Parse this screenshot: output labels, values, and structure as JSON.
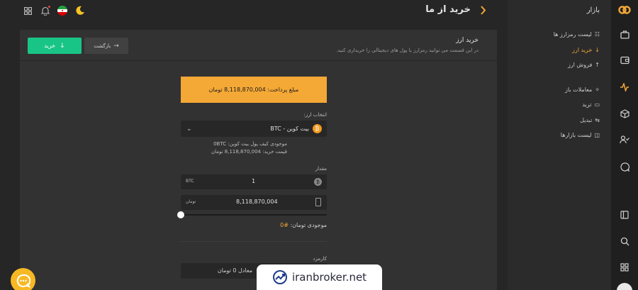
{
  "header": {
    "title": "خرید از ما",
    "chevron": "chevron-right-icon"
  },
  "topicons": [
    "theme-moon-icon",
    "iran-flag-icon",
    "bell-icon",
    "grid-icon"
  ],
  "colors": {
    "accent": "#f4a836",
    "green": "#19c586",
    "bg": "#262627",
    "panel": "#323233"
  },
  "page": {
    "title": "خرید ارز",
    "subtitle": "در این قسمت می توانید رمزارز یا پول های دیجیتالی را خریداری کنید.",
    "buy_button": "خرید",
    "back_button": "بازگشت"
  },
  "payment": {
    "label": "مبلغ پرداخت: 8,118,870,004 تومان"
  },
  "currency": {
    "label": "انتخاب ارز:",
    "selected": "بیت کوین - BTC",
    "wallet": "موجودی کیف پول بیت کوین: 0BTC",
    "price": "قیمت خرید: 8,118,870,004 تومان"
  },
  "amount": {
    "label": "مقدار",
    "crypto_value": "1",
    "crypto_unit": "BTC",
    "toman_value": "8,118,870,004",
    "toman_unit": "تومان",
    "slider_percent": 0,
    "balance_label": "موجودی تومان:",
    "balance_value": "#0"
  },
  "fee": {
    "label": "کارمزد",
    "value": "معادل 0 تومان"
  },
  "watermark": {
    "text": "iranbroker.net"
  },
  "sidebar": {
    "title": "بازار",
    "items": [
      {
        "label": "لیست رمزارز ها",
        "icon": "list-icon"
      },
      {
        "label": "خرید ارز",
        "icon": "arrow-down-icon",
        "active": true
      },
      {
        "label": "فروش ارز",
        "icon": "arrow-up-icon"
      },
      {
        "label": "معاملات باز",
        "icon": "sparkle-icon"
      },
      {
        "label": "ترید",
        "icon": "monitor-icon"
      },
      {
        "label": "تبدیل",
        "icon": "swap-icon"
      },
      {
        "label": "لیست بازارها",
        "icon": "chart-icon"
      }
    ]
  },
  "rail": [
    "logo-icon",
    "briefcase-icon",
    "wallet-icon",
    "activity-icon",
    "cube-icon",
    "user-check-icon",
    "chat-icon",
    "layout-icon",
    "search-icon",
    "apps-icon",
    "avatar-icon"
  ]
}
